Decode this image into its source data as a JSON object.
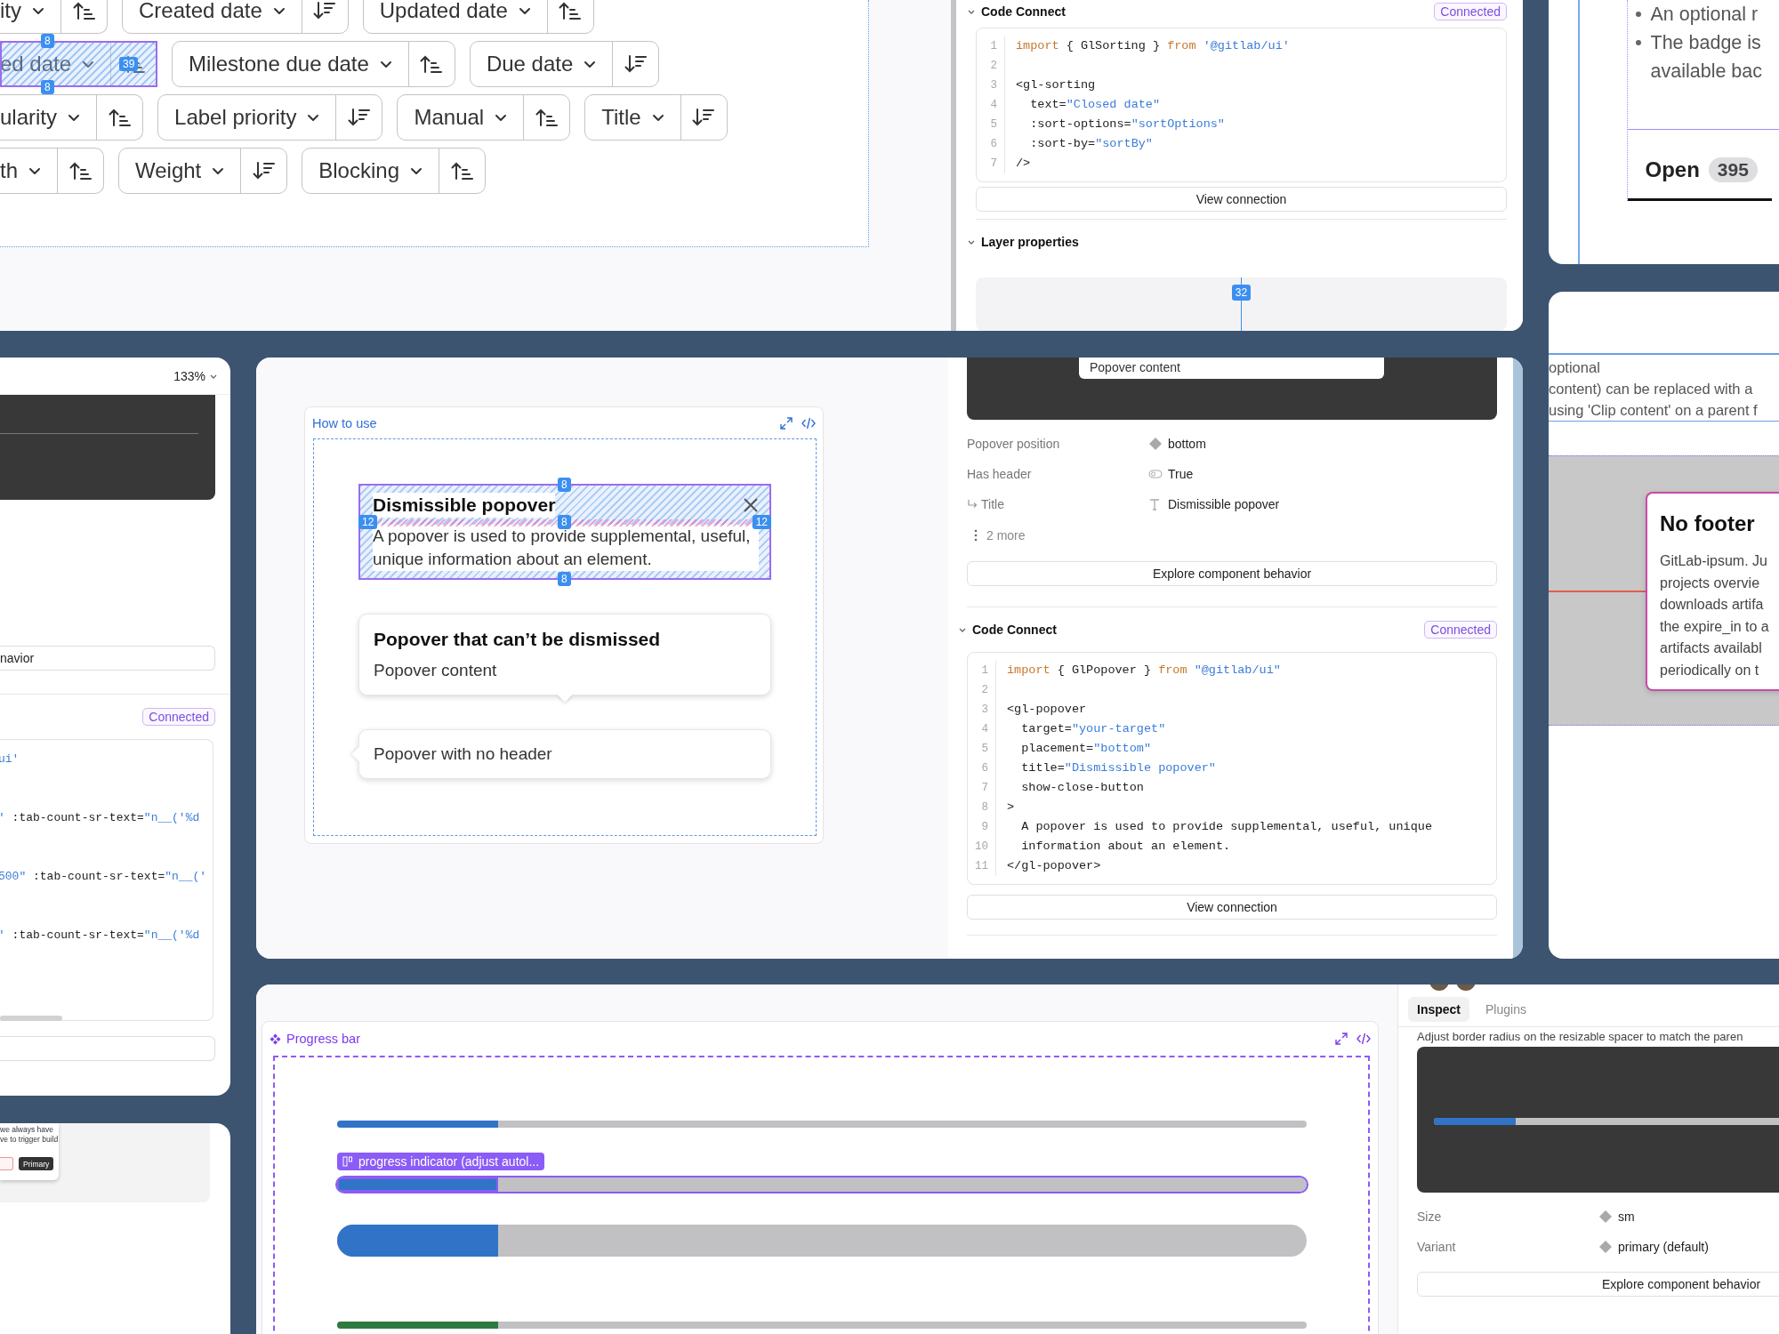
{
  "sorting_panel": {
    "rows": [
      [
        {
          "label": "ity",
          "kind": "ascending",
          "selected": false
        },
        {
          "label": "Created date",
          "kind": "descending",
          "selected": false
        },
        {
          "label": "Updated date",
          "kind": "ascending",
          "selected": false
        }
      ],
      [
        {
          "label": "ed date",
          "kind": "ascending",
          "selected": true,
          "badges": [
            "8",
            "39",
            "8"
          ]
        },
        {
          "label": "Milestone due date",
          "kind": "ascending",
          "selected": false
        },
        {
          "label": "Due date",
          "kind": "descending",
          "selected": false
        }
      ],
      [
        {
          "label": "ularity",
          "kind": "ascending",
          "selected": false
        },
        {
          "label": "Label priority",
          "kind": "descending",
          "selected": false
        },
        {
          "label": "Manual",
          "kind": "ascending",
          "selected": false
        },
        {
          "label": "Title",
          "kind": "descending",
          "selected": false
        }
      ],
      [
        {
          "label": "th",
          "kind": "ascending",
          "selected": false
        },
        {
          "label": "Weight",
          "kind": "descending",
          "selected": false
        },
        {
          "label": "Blocking",
          "kind": "ascending",
          "selected": false
        }
      ]
    ]
  },
  "sorting_inspector": {
    "code_connect": {
      "title": "Code Connect",
      "status": "Connected",
      "button": "View connection",
      "lines": [
        {
          "number": "1",
          "tokens": [
            {
              "text": "import",
              "kind": "keyword"
            },
            {
              "text": " { GlSorting } ",
              "kind": "plain"
            },
            {
              "text": "from",
              "kind": "keyword"
            },
            {
              "text": " '@gitlab/ui'",
              "kind": "string"
            }
          ]
        },
        {
          "number": "2"
        },
        {
          "number": "3",
          "tokens": [
            {
              "text": "<gl-sorting",
              "kind": "plain"
            }
          ]
        },
        {
          "number": "4",
          "tokens": [
            {
              "text": "  text=",
              "kind": "plain"
            },
            {
              "text": "\"Closed date\"",
              "kind": "string"
            }
          ]
        },
        {
          "number": "5",
          "tokens": [
            {
              "text": "  :sort-options=",
              "kind": "plain"
            },
            {
              "text": "\"sortOptions\"",
              "kind": "string"
            }
          ]
        },
        {
          "number": "6",
          "tokens": [
            {
              "text": "  :sort-by=",
              "kind": "plain"
            },
            {
              "text": "\"sortBy\"",
              "kind": "string"
            }
          ]
        },
        {
          "number": "7",
          "tokens": [
            {
              "text": "/>",
              "kind": "plain"
            }
          ]
        }
      ]
    },
    "layer_properties": {
      "title": "Layer properties",
      "badge": "32"
    }
  },
  "badge_doc": {
    "bullets": [
      {
        "lines": [
          "An optional r"
        ]
      },
      {
        "lines": [
          "The badge is",
          "available bac"
        ]
      }
    ],
    "tab": {
      "label": "Open",
      "count": "395"
    }
  },
  "left_inspector": {
    "zoom": "133%",
    "field": "navior",
    "status": "Connected",
    "lines": [
      {
        "tokens": [
          {
            "text": "ui'",
            "kind": "string"
          }
        ]
      },
      {
        "tokens": [
          {
            "text": "'",
            "kind": "string"
          },
          {
            "text": " :tab-count-sr-text=",
            "kind": "plain"
          },
          {
            "text": "\"n__('%d",
            "kind": "string"
          }
        ]
      },
      {
        "tokens": [
          {
            "text": "500\"",
            "kind": "string"
          },
          {
            "text": " :tab-count-sr-text=",
            "kind": "plain"
          },
          {
            "text": "\"n__('",
            "kind": "string"
          }
        ]
      },
      {
        "tokens": [
          {
            "text": "'",
            "kind": "string"
          },
          {
            "text": " :tab-count-sr-text=",
            "kind": "plain"
          },
          {
            "text": "\"n__('%d",
            "kind": "string"
          }
        ]
      }
    ]
  },
  "small_card": {
    "lines": [
      "we always have",
      "ve to trigger build"
    ],
    "button": "Primary"
  },
  "popover_demo": {
    "title": "How to use",
    "popovers": [
      {
        "kind": "dismissible",
        "title": "Dismissible popover",
        "body": "A popover is used to provide supplemental, useful, unique information about an element.",
        "selected": true,
        "badges": [
          "8",
          "12",
          "8",
          "12",
          "8"
        ]
      },
      {
        "kind": "header",
        "title": "Popover that can’t be dismissed",
        "body": "Popover content",
        "selected": false
      },
      {
        "kind": "plain",
        "body": "Popover with no header",
        "selected": false
      }
    ]
  },
  "popover_inspector": {
    "preview_text": "Popover content",
    "properties": [
      {
        "label": "Popover position",
        "kind": "variant",
        "value": "bottom"
      },
      {
        "label": "Has header",
        "kind": "boolean",
        "value": "True",
        "children": [
          {
            "label": "Title",
            "kind": "text",
            "value": "Dismissible popover"
          }
        ]
      }
    ],
    "more": "2 more",
    "explore": "Explore component behavior",
    "code_connect": {
      "title": "Code Connect",
      "status": "Connected",
      "button": "View connection",
      "lines": [
        {
          "number": "1",
          "tokens": [
            {
              "text": "import",
              "kind": "keyword"
            },
            {
              "text": " { GlPopover } ",
              "kind": "plain"
            },
            {
              "text": "from",
              "kind": "keyword"
            },
            {
              "text": " \"@gitlab/ui\"",
              "kind": "string"
            }
          ]
        },
        {
          "number": "2"
        },
        {
          "number": "3",
          "tokens": [
            {
              "text": "<gl-popover",
              "kind": "plain"
            }
          ]
        },
        {
          "number": "4",
          "tokens": [
            {
              "text": "  target=",
              "kind": "plain"
            },
            {
              "text": "\"your-target\"",
              "kind": "string"
            }
          ]
        },
        {
          "number": "5",
          "tokens": [
            {
              "text": "  placement=",
              "kind": "plain"
            },
            {
              "text": "\"bottom\"",
              "kind": "string"
            }
          ]
        },
        {
          "number": "6",
          "tokens": [
            {
              "text": "  title=",
              "kind": "plain"
            },
            {
              "text": "\"Dismissible popover\"",
              "kind": "string"
            }
          ]
        },
        {
          "number": "7",
          "tokens": [
            {
              "text": "  show-close-button",
              "kind": "plain"
            }
          ]
        },
        {
          "number": "8",
          "tokens": [
            {
              "text": ">",
              "kind": "plain"
            }
          ]
        },
        {
          "number": "9",
          "tokens": [
            {
              "text": "  A popover is used to provide supplemental, useful, unique",
              "kind": "plain"
            }
          ]
        },
        {
          "number": "10",
          "tokens": [
            {
              "text": "  information about an element.",
              "kind": "plain"
            }
          ]
        },
        {
          "number": "11",
          "tokens": [
            {
              "text": "</gl-popover>",
              "kind": "plain"
            }
          ]
        }
      ]
    }
  },
  "clip_doc": {
    "lines": [
      "optional",
      "content) can be replaced with a",
      "using 'Clip content' on a parent f"
    ],
    "card": {
      "title": "No footer",
      "lines": [
        "GitLab-ipsum. Ju",
        "projects overvie",
        "downloads artifa",
        "the expire_in to a",
        "artifacts availabl",
        "periodically on t"
      ]
    }
  },
  "progress_demo": {
    "title": "Progress bar",
    "bars": [
      {
        "kind": "thin",
        "level": 0.166,
        "color": "#3173c6",
        "selected": false
      },
      {
        "kind": "medium",
        "level": 0.166,
        "color": "#3173c6",
        "selected": true,
        "label": "progress indicator (adjust autol..."
      },
      {
        "kind": "thick",
        "level": 0.166,
        "color": "#3173c6",
        "selected": false
      },
      {
        "kind": "thin",
        "level": 0.166,
        "color": "#2f7a3f",
        "selected": false
      }
    ]
  },
  "progress_inspector": {
    "tabs": [
      {
        "label": "Inspect",
        "selected": true
      },
      {
        "label": "Plugins",
        "selected": false
      }
    ],
    "hint": "Adjust border radius on the resizable spacer to match the paren",
    "preview": {
      "level": 0.166
    },
    "properties": [
      {
        "label": "Size",
        "kind": "variant",
        "value": "sm"
      },
      {
        "label": "Variant",
        "kind": "variant",
        "value": "primary (default)"
      }
    ],
    "explore": "Explore component behavior"
  }
}
